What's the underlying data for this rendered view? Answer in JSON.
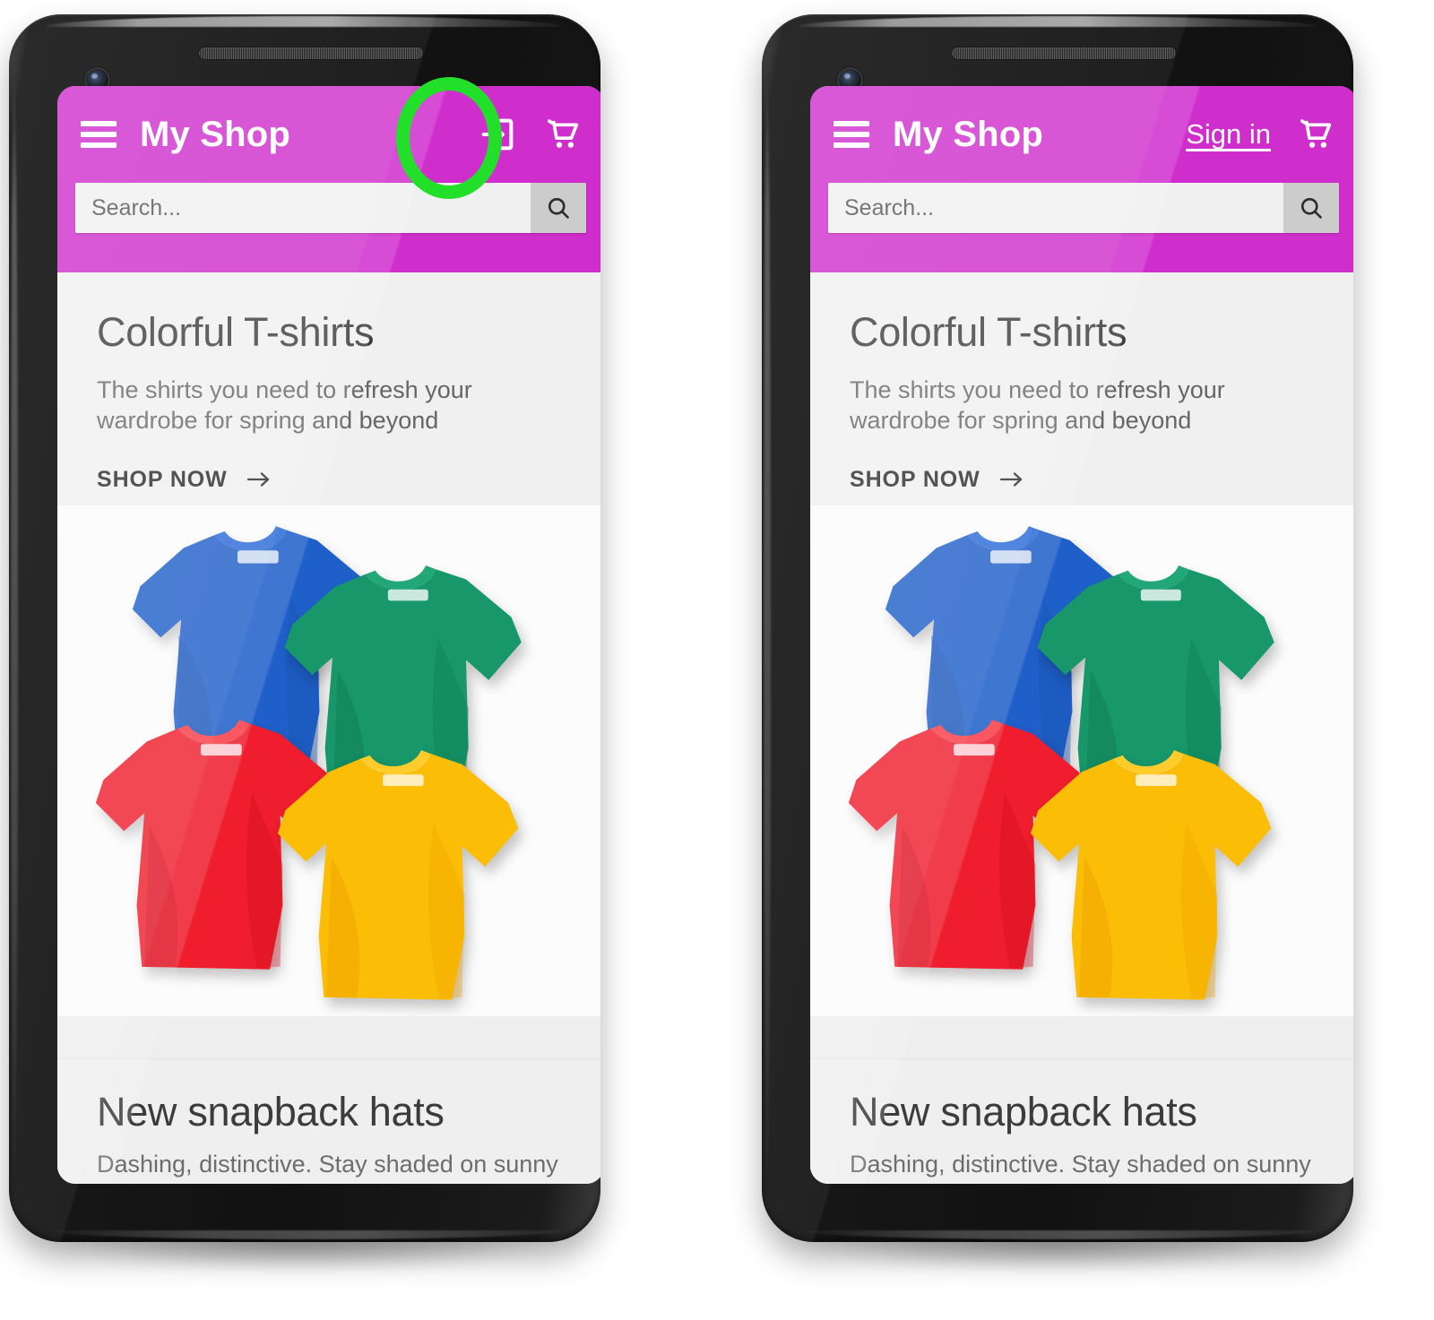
{
  "meta": {
    "scene": "Two Android phone mockups side by side showing a mobile shop app header, with a green highlight ring around the account control",
    "accent_magenta": "#cf2ecd",
    "highlight_green": "#22e02a",
    "page_bg": "#eeeeee"
  },
  "phones": [
    {
      "id": "left-phone",
      "variant": "icon",
      "appbar": {
        "menu_icon": "hamburger-menu-icon",
        "title": "My Shop",
        "account_icon": "login-arrow-icon",
        "account_label": "",
        "cart_icon": "shopping-cart-icon"
      },
      "search": {
        "placeholder": "Search...",
        "value": "",
        "button_icon": "search-icon"
      },
      "highlight": "login-arrow-icon"
    },
    {
      "id": "right-phone",
      "variant": "text",
      "appbar": {
        "menu_icon": "hamburger-menu-icon",
        "title": "My Shop",
        "account_icon": "",
        "account_label": "Sign in",
        "cart_icon": "shopping-cart-icon"
      },
      "search": {
        "placeholder": "Search...",
        "value": "",
        "button_icon": "search-icon"
      },
      "highlight": "sign-in-link"
    }
  ],
  "content": {
    "card1": {
      "title": "Colorful T-shirts",
      "subtitle": "The shirts you need to refresh your wardrobe for spring and beyond",
      "cta_label": "SHOP NOW",
      "cta_icon": "arrow-right-icon"
    },
    "card2": {
      "title": "New snapback hats",
      "subtitle": "Dashing, distinctive. Stay shaded on sunny"
    },
    "hero_products": [
      {
        "name": "blue-tshirt",
        "color": "#1f5fc9"
      },
      {
        "name": "green-tshirt",
        "color": "#17976a"
      },
      {
        "name": "red-tshirt",
        "color": "#ef1d2d"
      },
      {
        "name": "yellow-tshirt",
        "color": "#fcbd06"
      }
    ]
  }
}
